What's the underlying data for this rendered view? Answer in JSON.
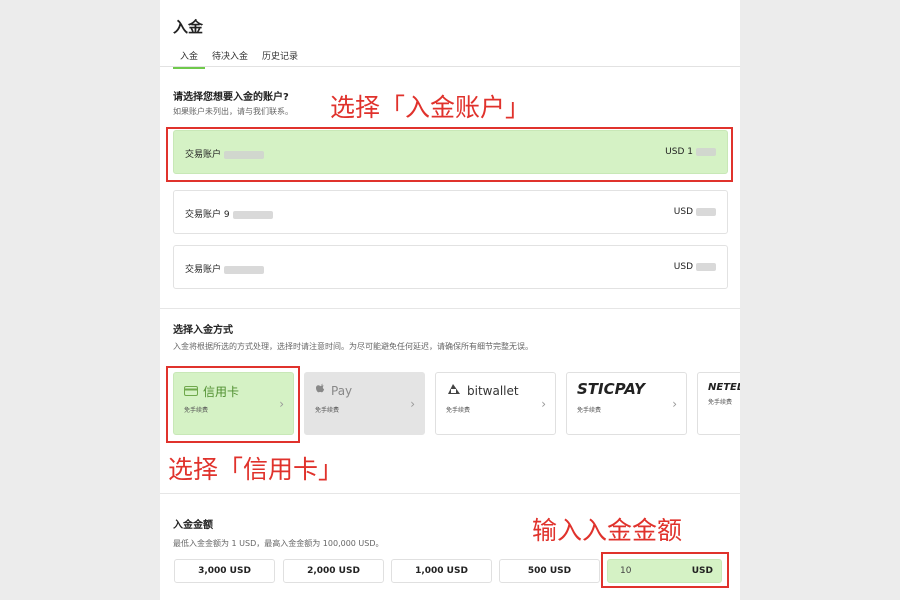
{
  "header": {
    "title": "入金"
  },
  "tabs": [
    {
      "label": "入金"
    },
    {
      "label": "待决入金"
    },
    {
      "label": "历史记录"
    }
  ],
  "account_section": {
    "title": "请选择您想要入金的账户?",
    "subtitle": "如果账户未列出，请与我们联系。",
    "accounts": [
      {
        "label": "交易账户",
        "currency": "USD 1"
      },
      {
        "label": "交易账户 9",
        "currency": "USD"
      },
      {
        "label": "交易账户",
        "currency": "USD"
      }
    ]
  },
  "method_section": {
    "title": "选择入金方式",
    "subtitle": "入金将根据所选的方式处理，选择时请注意时间。为尽可能避免任何延迟，请确保所有细节完整无误。",
    "methods": [
      {
        "name": "信用卡",
        "fee": "免手续费",
        "icon": "credit-card-icon"
      },
      {
        "name": "Pay",
        "fee": "免手续费",
        "icon": "apple-icon"
      },
      {
        "name": "bitwallet",
        "fee": "免手续费",
        "icon": "bitwallet-logo-icon"
      },
      {
        "name": "STICPAY",
        "fee": "免手续费",
        "icon": ""
      },
      {
        "name": "NETELL",
        "fee": "免手续费",
        "icon": ""
      }
    ]
  },
  "amount_section": {
    "title": "入金金额",
    "subtitle": "最低入金金额为 1 USD，最高入金金额为 100,000 USD。",
    "presets": [
      "3,000 USD",
      "2,000 USD",
      "1,000 USD",
      "500 USD"
    ],
    "input_value": "10",
    "input_unit": "USD"
  },
  "annotations": {
    "account": "选择「入金账户」",
    "method": "选择「信用卡」",
    "amount": "输入入金金额"
  },
  "colors": {
    "selected_bg": "#d5f2c5",
    "accent_green": "#6fc94b",
    "annotation_red": "#e0322c"
  }
}
